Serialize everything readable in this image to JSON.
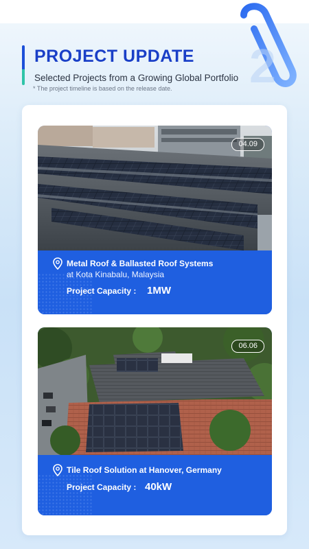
{
  "header": {
    "title": "PROJECT UPDATE",
    "subtitle": "Selected Projects from a Growing Global Portfolio",
    "note": "* The project timeline is based on the release date."
  },
  "projects": [
    {
      "date": "04.09",
      "location_line1": "Metal Roof & Ballasted Roof Systems",
      "location_line2": "at Kota Kinabalu, Malaysia",
      "capacity_label": "Project Capacity :",
      "capacity_value": "1MW",
      "icon": "location-pin-icon"
    },
    {
      "date": "06.06",
      "location_line1": "Tile Roof Solution at Hanover, Germany",
      "capacity_label": "Project Capacity :",
      "capacity_value": "40kW",
      "icon": "location-pin-icon"
    }
  ],
  "colors": {
    "brand_blue": "#1a3fc7",
    "card_blue": "#1f5fe0",
    "accent_teal": "#2fc4a8"
  }
}
